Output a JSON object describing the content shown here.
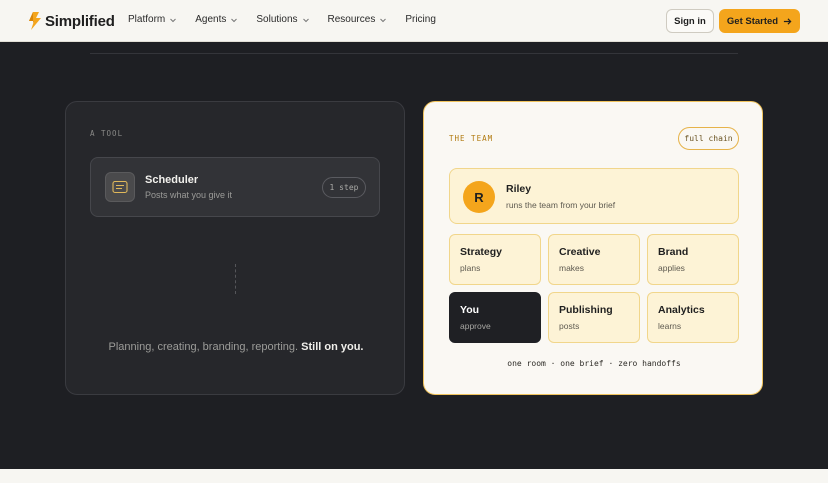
{
  "nav": {
    "brand": "Simplified",
    "menu": [
      {
        "label": "Platform",
        "dropdown": true
      },
      {
        "label": "Agents",
        "dropdown": true
      },
      {
        "label": "Solutions",
        "dropdown": true
      },
      {
        "label": "Resources",
        "dropdown": true
      },
      {
        "label": "Pricing",
        "dropdown": false
      }
    ],
    "sign_in": "Sign in",
    "get_started": "Get Started",
    "accent": "#f4a51c"
  },
  "tool": {
    "eyebrow": "A TOOL",
    "item_title": "Scheduler",
    "item_sub": "Posts what you give it",
    "step": "1 step",
    "caption_plain": "Planning, creating, branding, reporting. ",
    "caption_bold": "Still on you."
  },
  "team": {
    "eyebrow": "THE TEAM",
    "badge": "full chain",
    "lead_initial": "R",
    "lead_name": "Riley",
    "lead_sub": "runs the team from your brief",
    "roles": [
      {
        "title": "Strategy",
        "sub": "plans"
      },
      {
        "title": "Creative",
        "sub": "makes"
      },
      {
        "title": "Brand",
        "sub": "applies"
      },
      {
        "title": "You",
        "sub": "approve"
      },
      {
        "title": "Publishing",
        "sub": "posts"
      },
      {
        "title": "Analytics",
        "sub": "learns"
      }
    ],
    "caption": "one room · one brief · zero handoffs"
  }
}
